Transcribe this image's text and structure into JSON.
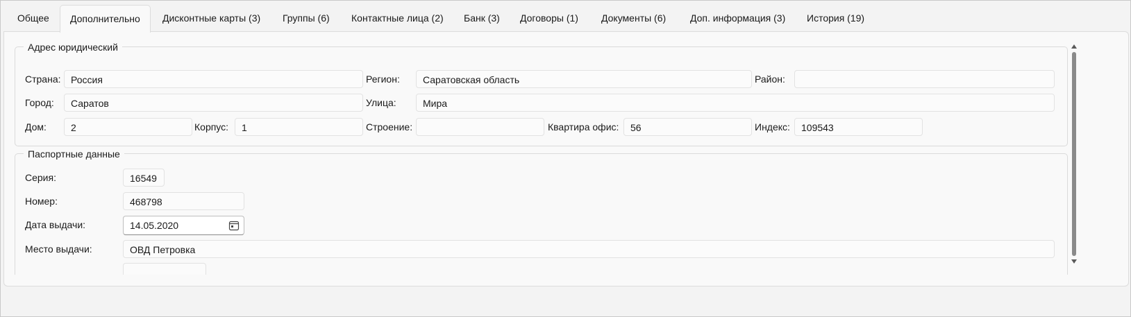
{
  "tabs": [
    {
      "label": "Общее"
    },
    {
      "label": "Дополнительно"
    },
    {
      "label": "Дисконтные карты (3)"
    },
    {
      "label": "Группы (6)"
    },
    {
      "label": "Контактные лица (2)"
    },
    {
      "label": "Банк (3)"
    },
    {
      "label": "Договоры (1)"
    },
    {
      "label": "Документы  (6)"
    },
    {
      "label": "Доп. информация (3)"
    },
    {
      "label": "История (19)"
    }
  ],
  "active_tab": "Дополнительно",
  "address": {
    "title": "Адрес юридический",
    "country_label": "Страна:",
    "country": "Россия",
    "region_label": "Регион:",
    "region": "Саратовская область",
    "district_label": "Район:",
    "district": "",
    "city_label": "Город:",
    "city": "Саратов",
    "street_label": "Улица:",
    "street": "Мира",
    "house_label": "Дом:",
    "house": "2",
    "building_label": "Корпус:",
    "building": "1",
    "structure_label": "Строение:",
    "structure": "",
    "apartment_label": "Квартира офис:",
    "apartment": "56",
    "index_label": "Индекс:",
    "index": "109543"
  },
  "passport": {
    "title": "Паспортные данные",
    "series_label": "Серия:",
    "series": "16549",
    "number_label": "Номер:",
    "number": "468798",
    "issue_date_label": "Дата выдачи:",
    "issue_date": "14.05.2020",
    "issue_place_label": "Место выдачи:",
    "issue_place": "ОВД Петровка",
    "extra_value": ""
  }
}
